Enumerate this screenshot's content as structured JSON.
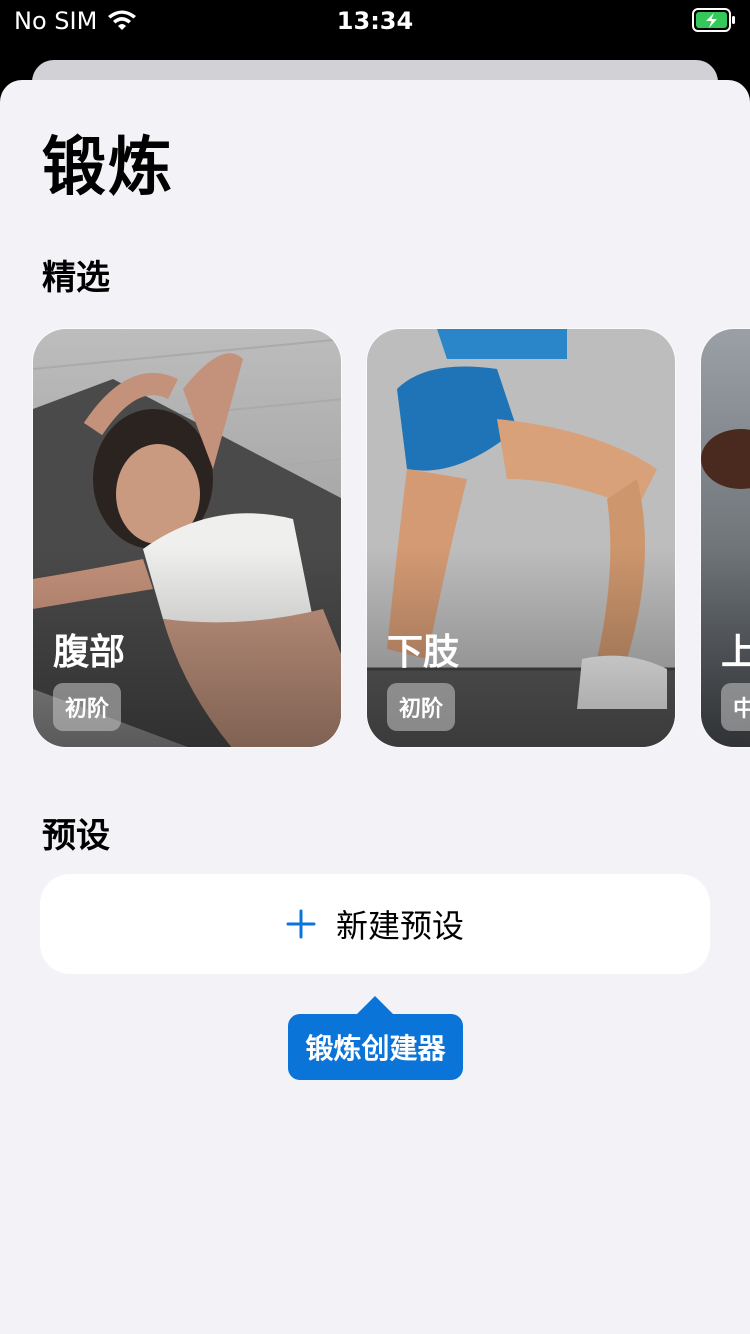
{
  "status_bar": {
    "carrier": "No SIM",
    "time": "13:34",
    "battery_color": "#34c759"
  },
  "page": {
    "title": "锻炼"
  },
  "featured": {
    "section_title": "精选",
    "cards": [
      {
        "title": "腹部",
        "level": "初阶"
      },
      {
        "title": "下肢",
        "level": "初阶"
      },
      {
        "title": "上",
        "level": "中"
      }
    ]
  },
  "presets": {
    "section_title": "预设",
    "new_preset_label": "新建预设",
    "plus_icon": "plus-icon"
  },
  "tooltip": {
    "text": "锻炼创建器"
  },
  "colors": {
    "accent": "#0a74d9",
    "background": "#f2f2f7"
  }
}
